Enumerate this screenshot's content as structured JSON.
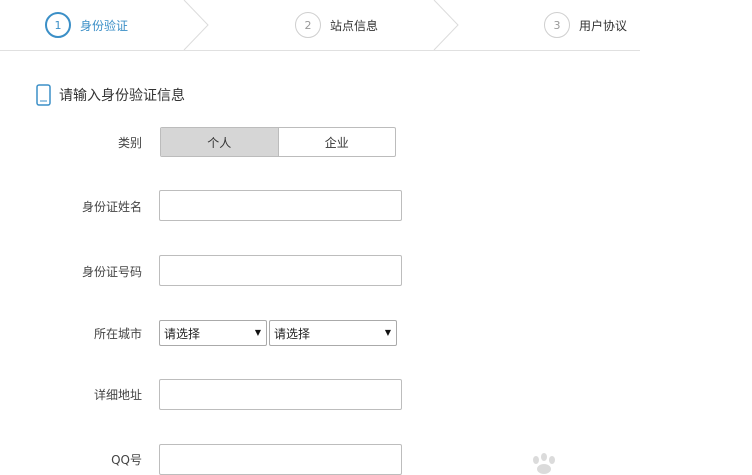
{
  "stepper": {
    "steps": [
      {
        "number": "1",
        "label": "身份验证"
      },
      {
        "number": "2",
        "label": "站点信息"
      },
      {
        "number": "3",
        "label": "用户协议"
      }
    ]
  },
  "section": {
    "title": "请输入身份验证信息",
    "icon": "mobile-phone-icon"
  },
  "form": {
    "type": {
      "label": "类别",
      "options": [
        "个人",
        "企业"
      ],
      "selected": "个人"
    },
    "id_name": {
      "label": "身份证姓名",
      "value": ""
    },
    "id_number": {
      "label": "身份证号码",
      "value": ""
    },
    "city": {
      "label": "所在城市",
      "select1": "请选择",
      "select2": "请选择"
    },
    "address": {
      "label": "详细地址",
      "value": ""
    },
    "qq": {
      "label": "QQ号",
      "value": ""
    }
  },
  "colors": {
    "accent": "#3b8fc7",
    "selected_segment": "#d6d6d6"
  },
  "watermark_icon": "paw-print-icon"
}
